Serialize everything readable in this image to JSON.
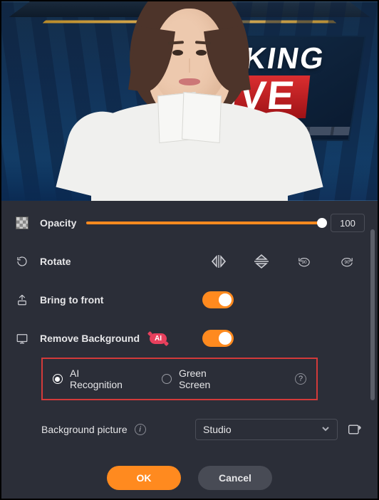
{
  "preview": {
    "news_line1": "EAKING",
    "news_live": "IVE"
  },
  "opacity": {
    "label": "Opacity",
    "value": "100"
  },
  "rotate": {
    "label": "Rotate",
    "rot_left_hint": "90",
    "rot_right_hint": "90"
  },
  "bring_front": {
    "label": "Bring to front"
  },
  "remove_bg": {
    "label": "Remove Background",
    "badge": "AI"
  },
  "bg_method": {
    "options": [
      {
        "label": "AI Recognition"
      },
      {
        "label": "Green Screen"
      }
    ],
    "help": "?"
  },
  "bg_picture": {
    "label": "Background picture",
    "info": "i",
    "selected": "Studio"
  },
  "footer": {
    "ok": "OK",
    "cancel": "Cancel"
  },
  "colors": {
    "accent": "#ff8a1f",
    "danger": "#d33a3a",
    "badge": "#e8405d"
  }
}
